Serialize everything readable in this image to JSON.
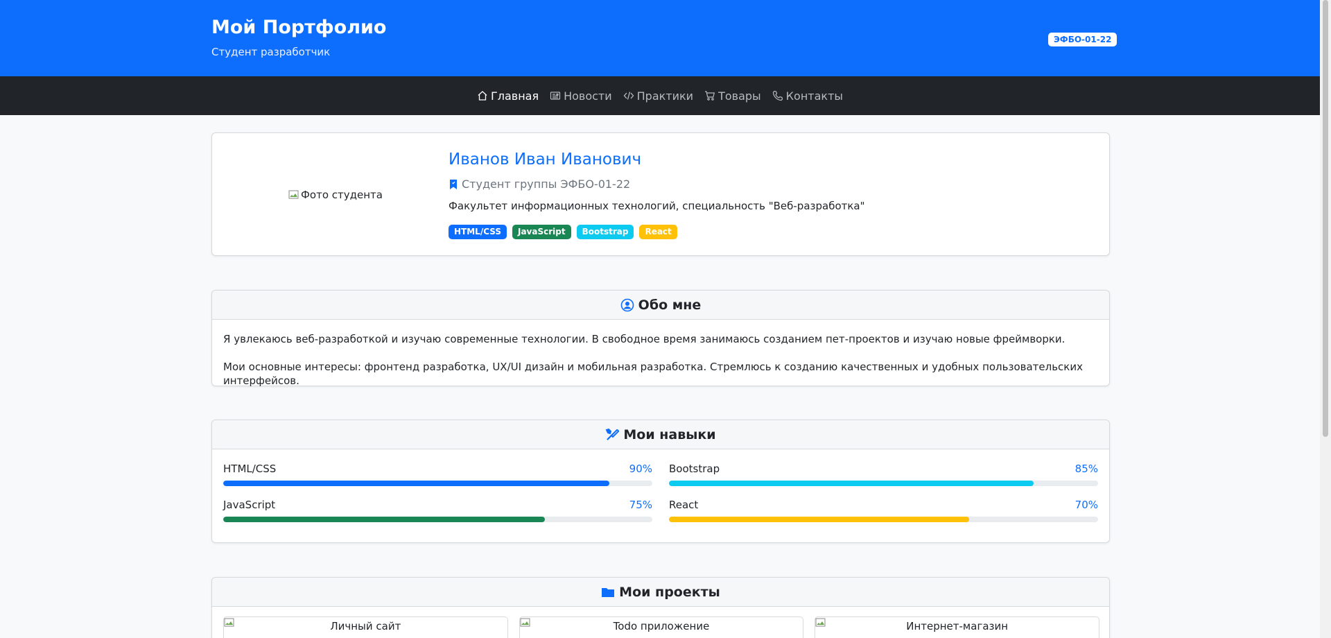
{
  "header": {
    "title": "Мой Портфолио",
    "subtitle": "Студент разработчик",
    "group_badge": "ЭФБО-01-22"
  },
  "nav": {
    "items": [
      {
        "label": "Главная",
        "icon": "house-icon",
        "active": true
      },
      {
        "label": "Новости",
        "icon": "newspaper-icon"
      },
      {
        "label": "Практики",
        "icon": "code-icon"
      },
      {
        "label": "Товары",
        "icon": "cart-icon"
      },
      {
        "label": "Контакты",
        "icon": "phone-icon"
      }
    ]
  },
  "profile": {
    "photo_alt": "Фото студента",
    "name": "Иванов Иван Иванович",
    "group": "Студент группы ЭФБО-01-22",
    "faculty": "Факультет информационных технологий, специальность \"Веб-разработка\"",
    "tags": [
      {
        "label": "HTML/CSS",
        "color": "#0d6efd"
      },
      {
        "label": "JavaScript",
        "color": "#198754"
      },
      {
        "label": "Bootstrap",
        "color": "#0dcaf0"
      },
      {
        "label": "React",
        "color": "#ffc107"
      }
    ]
  },
  "about": {
    "title": "Обо мне",
    "p1": "Я увлекаюсь веб-разработкой и изучаю современные технологии. В свободное время занимаюсь созданием пет-проектов и изучаю новые фреймворки.",
    "p2": "Мои основные интересы: фронтенд разработка, UX/UI дизайн и мобильная разработка. Стремлюсь к созданию качественных и удобных пользовательских интерфейсов."
  },
  "skills": {
    "title": "Мои навыки",
    "items": [
      {
        "name": "HTML/CSS",
        "pct_label": "90%",
        "value": 90,
        "color": "#0d6efd"
      },
      {
        "name": "Bootstrap",
        "pct_label": "85%",
        "value": 85,
        "color": "#0dcaf0"
      },
      {
        "name": "JavaScript",
        "pct_label": "75%",
        "value": 75,
        "color": "#198754"
      },
      {
        "name": "React",
        "pct_label": "70%",
        "value": 70,
        "color": "#ffc107"
      }
    ]
  },
  "projects": {
    "title": "Мои проекты",
    "items": [
      {
        "alt": "Личный сайт"
      },
      {
        "alt": "Todo приложение"
      },
      {
        "alt": "Интернет-магазин"
      }
    ]
  },
  "colors": {
    "primary": "#0d6efd",
    "dark": "#212529"
  }
}
